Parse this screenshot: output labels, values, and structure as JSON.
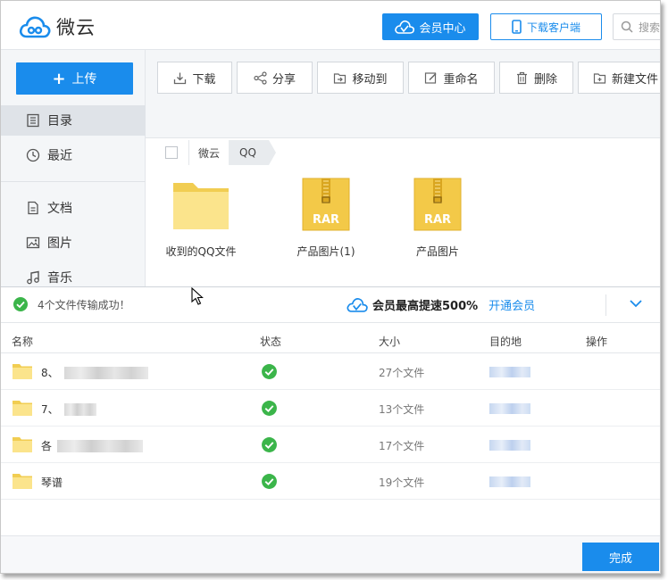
{
  "app": {
    "name": "微云"
  },
  "header": {
    "vip_label": "会员中心",
    "client_label": "下载客户端",
    "search_placeholder": "搜索"
  },
  "sidebar": {
    "upload_label": "上传",
    "items": [
      {
        "label": "目录",
        "icon": "directory-icon",
        "active": true
      },
      {
        "label": "最近",
        "icon": "clock-icon",
        "active": false
      },
      {
        "label": "文档",
        "icon": "document-icon",
        "active": false
      },
      {
        "label": "图片",
        "icon": "image-icon",
        "active": false
      },
      {
        "label": "音乐",
        "icon": "music-icon",
        "active": false
      }
    ]
  },
  "toolbar": {
    "download": "下载",
    "share": "分享",
    "move": "移动到",
    "rename": "重命名",
    "delete": "删除",
    "new_file": "新建文件"
  },
  "breadcrumb": {
    "root": "微云",
    "current": "QQ"
  },
  "files": [
    {
      "name": "收到的QQ文件",
      "type": "folder"
    },
    {
      "name": "产品图片(1)",
      "type": "rar",
      "badge": "RAR"
    },
    {
      "name": "产品图片",
      "type": "rar",
      "badge": "RAR"
    }
  ],
  "transfer": {
    "success_message": "4个文件传输成功！",
    "promo_text": "会员最高提速500%",
    "promo_link": "开通会员",
    "columns": {
      "name": "名称",
      "status": "状态",
      "size": "大小",
      "dest": "目的地",
      "action": "操作"
    },
    "rows": [
      {
        "prefix": "8、",
        "size": "27个文件"
      },
      {
        "prefix": "7、",
        "size": "13个文件"
      },
      {
        "prefix": "各",
        "size": "17个文件"
      },
      {
        "prefix": "琴谱",
        "size": "19个文件"
      }
    ],
    "done_label": "完成"
  },
  "colors": {
    "accent": "#1a8cec",
    "folder": "#f5d565",
    "success": "#3bb54a"
  }
}
